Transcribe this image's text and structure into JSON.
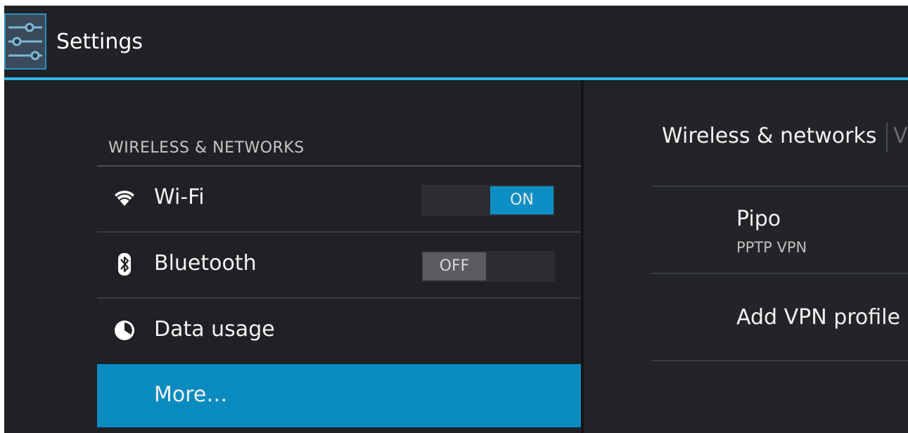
{
  "app": {
    "title": "Settings"
  },
  "sidebar": {
    "section_header": "WIRELESS & NETWORKS",
    "items": [
      {
        "label": "Wi-Fi",
        "icon": "wifi-icon",
        "toggle": "ON"
      },
      {
        "label": "Bluetooth",
        "icon": "bluetooth-icon",
        "toggle": "OFF"
      },
      {
        "label": "Data usage",
        "icon": "data-usage-icon"
      },
      {
        "label": "More…",
        "selected": true
      }
    ]
  },
  "detail": {
    "breadcrumb": "Wireless & networks",
    "breadcrumb_next": "V",
    "vpn_profiles": [
      {
        "name": "Pipo",
        "type": "PPTP VPN"
      }
    ],
    "add_profile_label": "Add VPN profile"
  },
  "colors": {
    "accent": "#33b5e5",
    "selected_row": "#0a8bbf",
    "background": "#1f2124"
  }
}
